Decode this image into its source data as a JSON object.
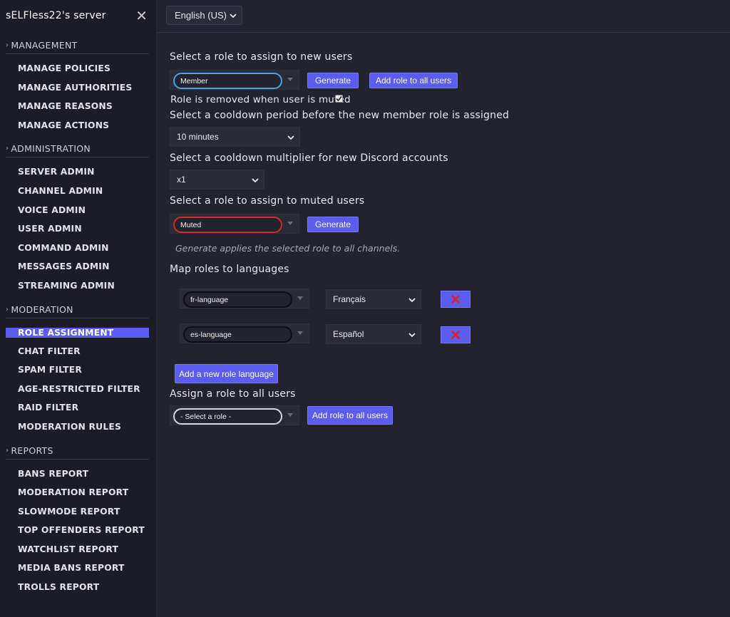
{
  "sidebar": {
    "server_name": "sELFless22's server",
    "sections": [
      {
        "title": "MANAGEMENT",
        "items": [
          "MANAGE POLICIES",
          "MANAGE AUTHORITIES",
          "MANAGE REASONS",
          "MANAGE ACTIONS"
        ]
      },
      {
        "title": "ADMINISTRATION",
        "items": [
          "SERVER ADMIN",
          "CHANNEL ADMIN",
          "VOICE ADMIN",
          "USER ADMIN",
          "COMMAND ADMIN",
          "MESSAGES ADMIN",
          "STREAMING ADMIN"
        ]
      },
      {
        "title": "MODERATION",
        "items": [
          "ROLE ASSIGNMENT",
          "CHAT FILTER",
          "SPAM FILTER",
          "AGE-RESTRICTED FILTER",
          "RAID FILTER",
          "MODERATION RULES"
        ]
      },
      {
        "title": "REPORTS",
        "items": [
          "BANS REPORT",
          "MODERATION REPORT",
          "SLOWMODE REPORT",
          "TOP OFFENDERS REPORT",
          "WATCHLIST REPORT",
          "MEDIA BANS REPORT",
          "TROLLS REPORT"
        ]
      }
    ],
    "active_item": "ROLE ASSIGNMENT"
  },
  "topbar": {
    "language": "English (US)"
  },
  "main": {
    "new_users": {
      "label": "Select a role to assign to new users",
      "role": "Member",
      "role_border_color": "#4aa3df",
      "generate": "Generate",
      "add_all": "Add role to all users",
      "muted_removed_label": "Role is removed when user is muted",
      "muted_removed_checked": true
    },
    "cooldown": {
      "label": "Select a cooldown period before the new member role is assigned",
      "value": "10 minutes"
    },
    "multiplier": {
      "label": "Select a cooldown multiplier for new Discord accounts",
      "value": "x1"
    },
    "muted": {
      "label": "Select a role to assign to muted users",
      "role": "Muted",
      "role_border_color": "#d42a2a",
      "generate": "Generate",
      "help": "Generate applies the selected role to all channels."
    },
    "languages": {
      "label": "Map roles to languages",
      "rows": [
        {
          "role": "fr-language",
          "language": "Français"
        },
        {
          "role": "es-language",
          "language": "Español"
        }
      ],
      "add_button": "Add a new role language"
    },
    "assign_all": {
      "label": "Assign a role to all users",
      "role": "- Select a role -",
      "add_all": "Add role to all users"
    }
  },
  "colors": {
    "accent": "#5b5cf0",
    "background": "#22232f",
    "sidebar": "#1c1c27",
    "delete_x": "#e0201e"
  }
}
